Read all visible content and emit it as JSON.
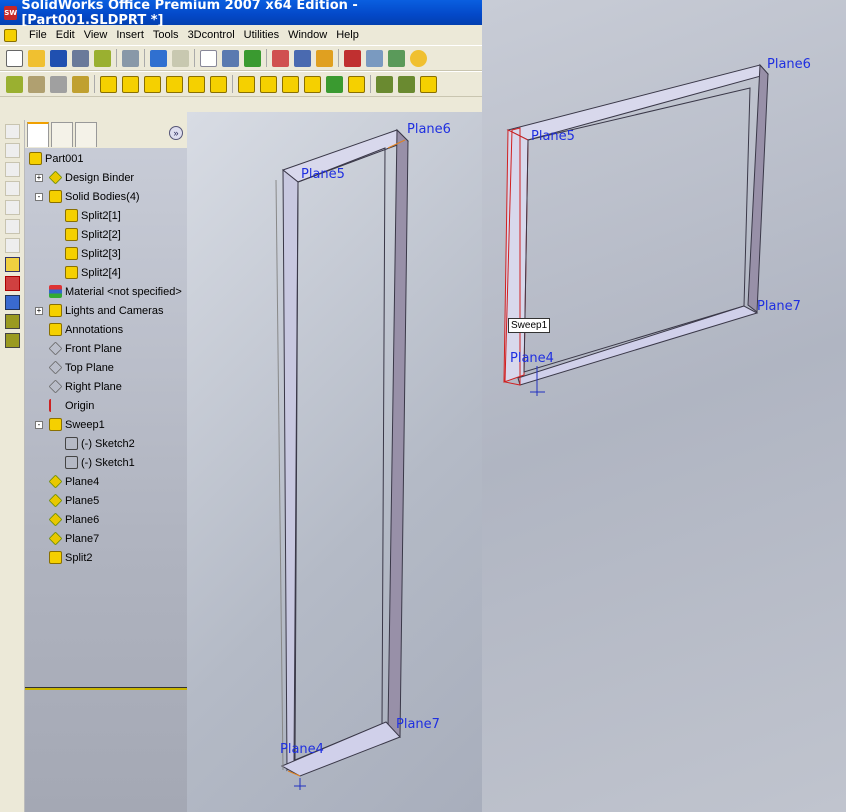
{
  "window": {
    "title": "SolidWorks Office Premium 2007 x64 Edition - [Part001.SLDPRT *]",
    "logo": "SW"
  },
  "menu": [
    "File",
    "Edit",
    "View",
    "Insert",
    "Tools",
    "3Dcontrol",
    "Utilities",
    "Window",
    "Help"
  ],
  "tree": {
    "expand_label": "»",
    "nodes": [
      {
        "label": "Part001",
        "icon": "part-icon",
        "level": 0
      },
      {
        "label": "Design Binder",
        "icon": "binder-icon",
        "level": 1,
        "toggle": "+"
      },
      {
        "label": "Solid Bodies(4)",
        "icon": "folder-icon",
        "level": 1,
        "toggle": "-"
      },
      {
        "label": "Split2[1]",
        "icon": "body-icon",
        "level": 2
      },
      {
        "label": "Split2[2]",
        "icon": "body-icon",
        "level": 2
      },
      {
        "label": "Split2[3]",
        "icon": "body-icon",
        "level": 2
      },
      {
        "label": "Split2[4]",
        "icon": "body-icon",
        "level": 2
      },
      {
        "label": "Material <not specified>",
        "icon": "material-icon",
        "level": 1
      },
      {
        "label": "Lights and Cameras",
        "icon": "lights-icon",
        "level": 1,
        "toggle": "+"
      },
      {
        "label": "Annotations",
        "icon": "annotations-icon",
        "level": 1
      },
      {
        "label": "Front Plane",
        "icon": "plane-icon",
        "level": 1
      },
      {
        "label": "Top Plane",
        "icon": "plane-icon",
        "level": 1
      },
      {
        "label": "Right Plane",
        "icon": "plane-icon",
        "level": 1
      },
      {
        "label": "Origin",
        "icon": "origin-icon",
        "level": 1
      },
      {
        "label": "Sweep1",
        "icon": "sweep-icon",
        "level": 1,
        "toggle": "-"
      },
      {
        "label": "(-) Sketch2",
        "icon": "sketch-icon",
        "level": 2
      },
      {
        "label": "(-) Sketch1",
        "icon": "sketch-icon",
        "level": 2
      },
      {
        "label": "Plane4",
        "icon": "ref-plane-icon",
        "level": 1
      },
      {
        "label": "Plane5",
        "icon": "ref-plane-icon",
        "level": 1
      },
      {
        "label": "Plane6",
        "icon": "ref-plane-icon",
        "level": 1
      },
      {
        "label": "Plane7",
        "icon": "ref-plane-icon",
        "level": 1
      },
      {
        "label": "Split2",
        "icon": "split-icon",
        "level": 1
      }
    ]
  },
  "viewport1": {
    "labels": [
      "Plane6",
      "Plane5",
      "Plane7",
      "Plane4"
    ]
  },
  "viewport2": {
    "labels": [
      "Plane6",
      "Plane5",
      "Plane7",
      "Plane4"
    ],
    "tooltip": "Sweep1"
  }
}
